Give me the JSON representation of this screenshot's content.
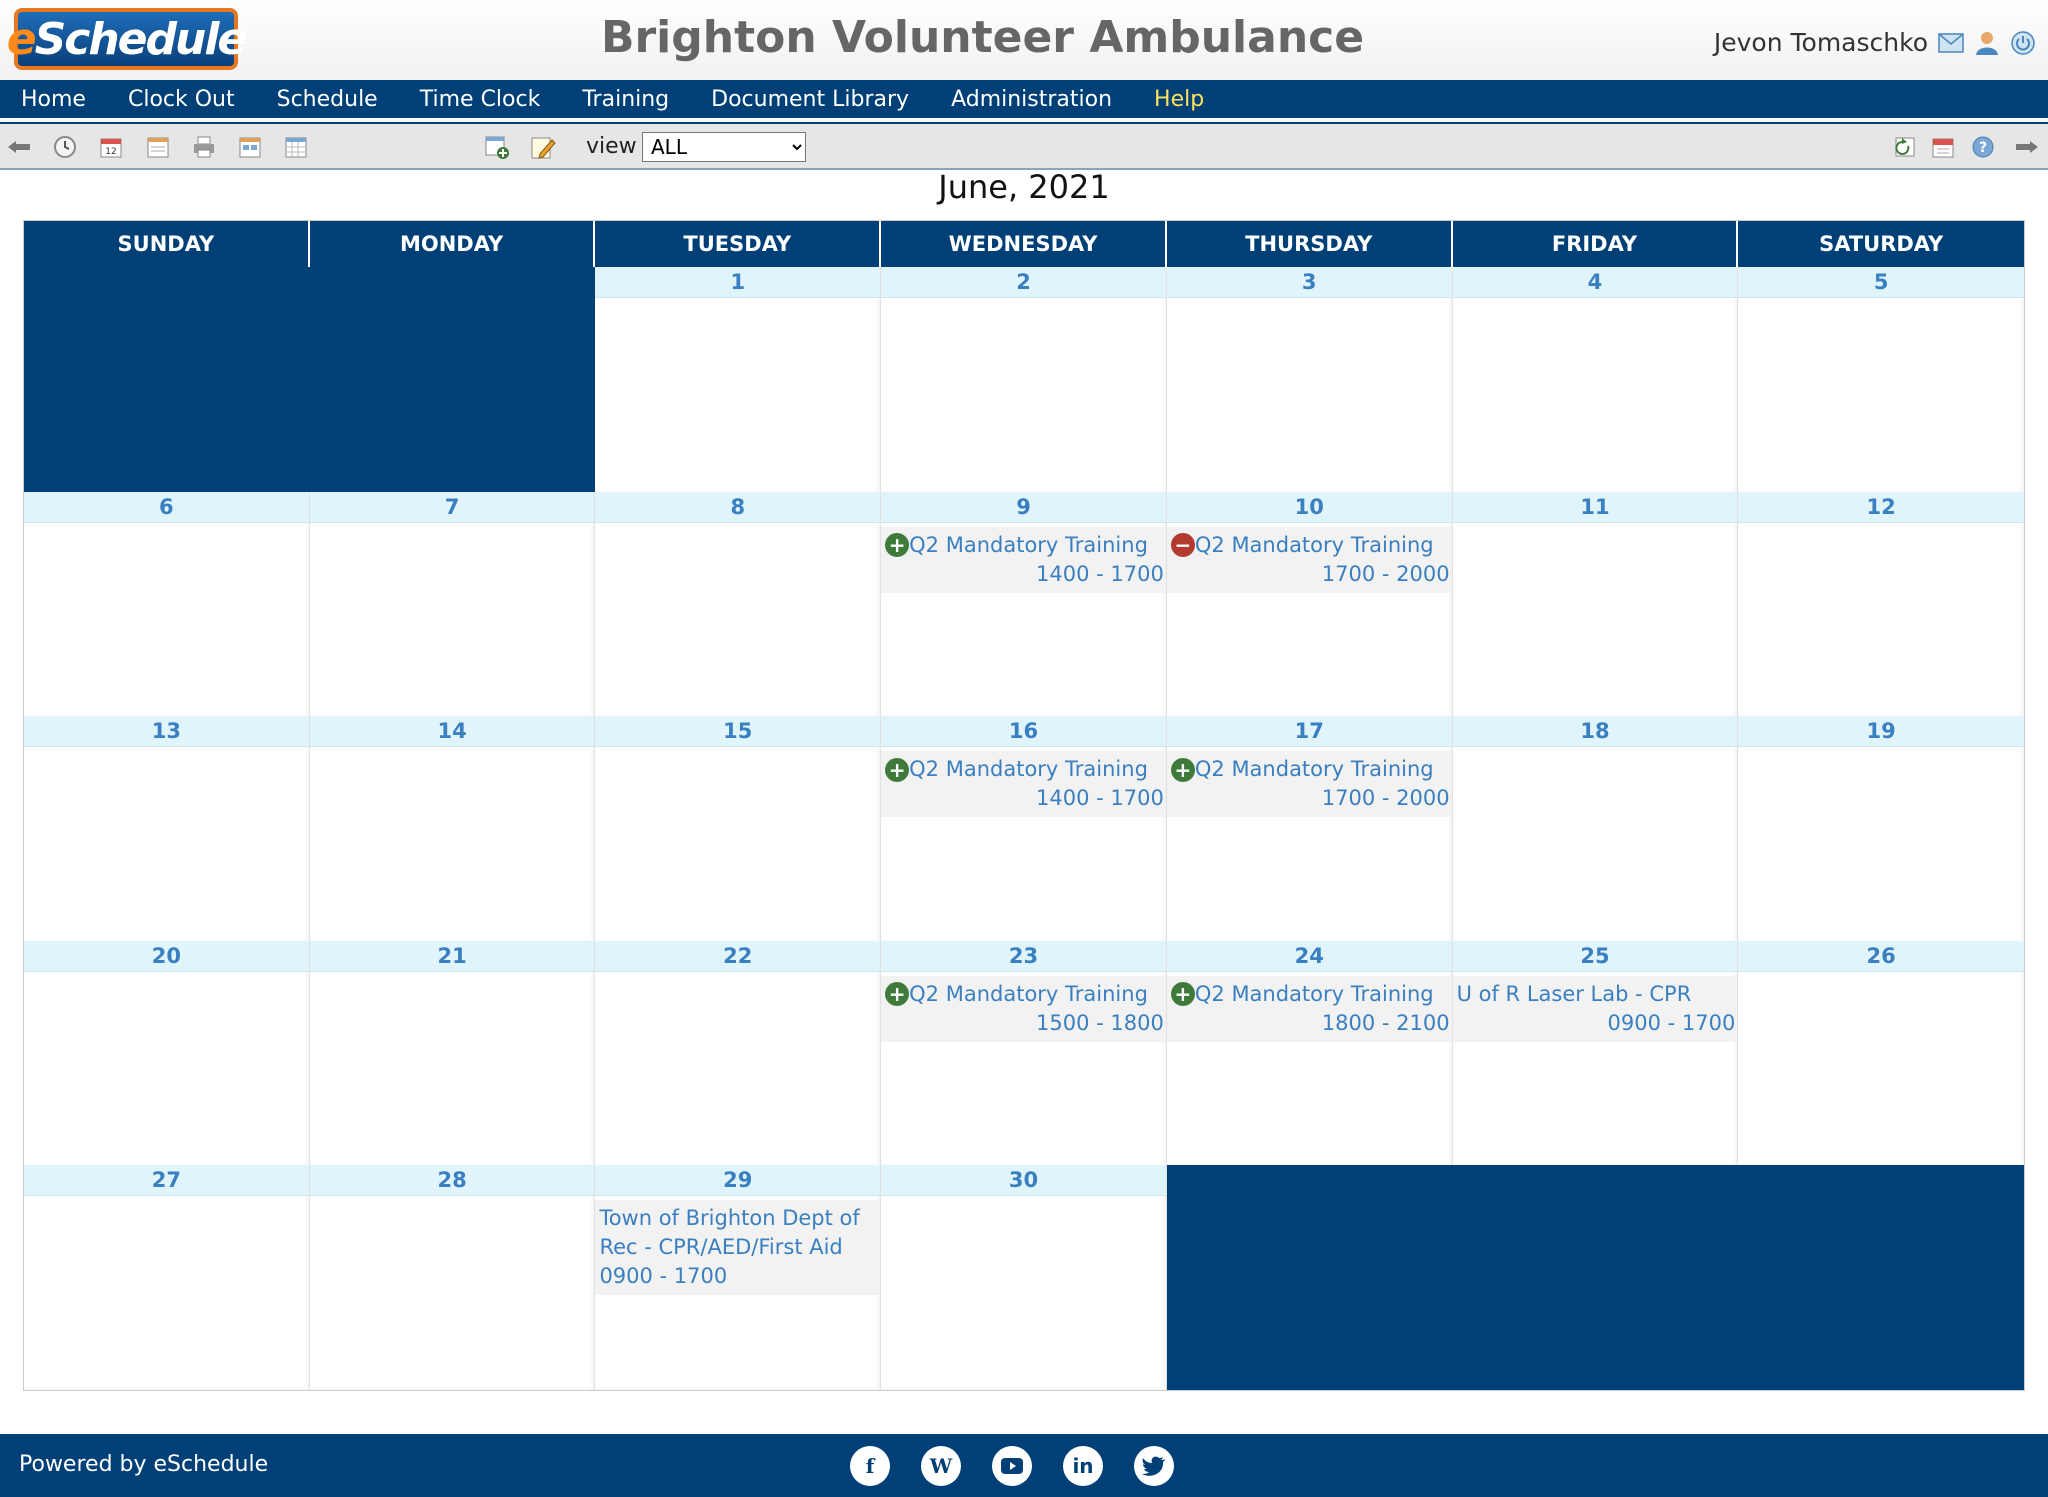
{
  "header": {
    "logo_text": "eSchedule",
    "org_name": "Brighton Volunteer Ambulance",
    "user_name": "Jevon Tomaschko"
  },
  "nav": {
    "items": [
      "Home",
      "Clock Out",
      "Schedule",
      "Time Clock",
      "Training",
      "Document Library",
      "Administration",
      "Help"
    ]
  },
  "toolbar": {
    "view_label": "view",
    "view_selected": "ALL"
  },
  "calendar": {
    "month_title": "June, 2021",
    "weekdays": [
      "SUNDAY",
      "MONDAY",
      "TUESDAY",
      "WEDNESDAY",
      "THURSDAY",
      "FRIDAY",
      "SATURDAY"
    ],
    "days": {
      "d1": "1",
      "d2": "2",
      "d3": "3",
      "d4": "4",
      "d5": "5",
      "d6": "6",
      "d7": "7",
      "d8": "8",
      "d9": "9",
      "d10": "10",
      "d11": "11",
      "d12": "12",
      "d13": "13",
      "d14": "14",
      "d15": "15",
      "d16": "16",
      "d17": "17",
      "d18": "18",
      "d19": "19",
      "d20": "20",
      "d21": "21",
      "d22": "22",
      "d23": "23",
      "d24": "24",
      "d25": "25",
      "d26": "26",
      "d27": "27",
      "d28": "28",
      "d29": "29",
      "d30": "30"
    },
    "events": {
      "e9": {
        "title": "Q2 Mandatory Training",
        "time": "1400 - 1700",
        "status": "plus"
      },
      "e10": {
        "title": "Q2 Mandatory Training",
        "time": "1700 - 2000",
        "status": "minus"
      },
      "e16": {
        "title": "Q2 Mandatory Training",
        "time": "1400 - 1700",
        "status": "plus"
      },
      "e17": {
        "title": "Q2 Mandatory Training",
        "time": "1700 - 2000",
        "status": "plus"
      },
      "e23": {
        "title": "Q2 Mandatory Training",
        "time": "1500 - 1800",
        "status": "plus"
      },
      "e24": {
        "title": "Q2 Mandatory Training",
        "time": "1800 - 2100",
        "status": "plus"
      },
      "e25": {
        "title": "U of R Laser Lab - CPR",
        "time": "0900 - 1700"
      },
      "e29": {
        "title": "Town of Brighton Dept of Rec - CPR/AED/First Aid",
        "time": "0900 - 1700"
      }
    }
  },
  "footer": {
    "powered_by": "Powered by eSchedule"
  },
  "colors": {
    "brand_navy": "#004077",
    "day_header_bg": "#e0f4fb",
    "link_blue": "#3a7fc0",
    "help_yellow": "#ffe15a",
    "logo_orange": "#e87722",
    "add_green": "#3f7a3a",
    "remove_red": "#b33a2e"
  },
  "icons": {
    "header": [
      "mail-icon",
      "user-profile-icon",
      "power-icon"
    ],
    "toolbar_left": [
      "back-arrow-icon",
      "clock-icon",
      "calendar-icon",
      "day-view-icon",
      "print-icon",
      "week-view-icon",
      "month-view-icon",
      "add-event-icon",
      "edit-note-icon"
    ],
    "toolbar_right": [
      "sync-icon",
      "calendar-export-icon",
      "help-icon",
      "forward-arrow-icon"
    ],
    "social": [
      "facebook-icon",
      "wordpress-icon",
      "youtube-icon",
      "linkedin-icon",
      "twitter-icon"
    ]
  }
}
